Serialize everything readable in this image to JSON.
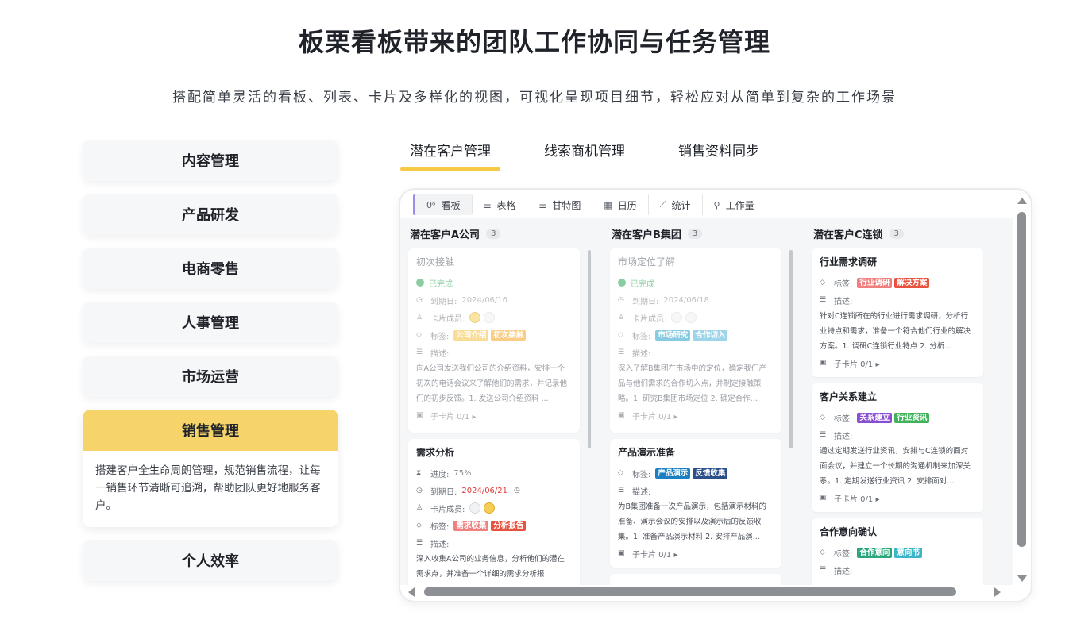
{
  "hero": {
    "title": "板栗看板带来的团队工作协同与任务管理",
    "subtitle": "搭配简单灵活的看板、列表、卡片及多样化的视图，可视化呈现项目细节，轻松应对从简单到复杂的工作场景"
  },
  "menu": {
    "items": [
      "内容管理",
      "产品研发",
      "电商零售",
      "人事管理",
      "市场运营"
    ],
    "active": {
      "label": "销售管理",
      "desc": "搭建客户全生命周朗管理，规范销售流程，让每一销售环节清晰可追溯，帮助团队更好地服务客户。"
    },
    "after": [
      "个人效率"
    ]
  },
  "tabs": [
    "潜在客户管理",
    "线索商机管理",
    "销售资料同步"
  ],
  "toolbar": [
    {
      "icon": "kanban-icon",
      "glyph": "0ᵒ",
      "label": "看板"
    },
    {
      "icon": "list-icon",
      "glyph": "☰",
      "label": "表格"
    },
    {
      "icon": "gantt-icon",
      "glyph": "☰",
      "label": "甘特图"
    },
    {
      "icon": "calendar-icon",
      "glyph": "▦",
      "label": "日历"
    },
    {
      "icon": "chart-icon",
      "glyph": "⟋",
      "label": "统计"
    },
    {
      "icon": "workload-icon",
      "glyph": "⚲",
      "label": "工作量"
    }
  ],
  "labels": {
    "done": "已完成",
    "due": "到期日:",
    "members": "卡片成员:",
    "tags": "标签:",
    "desc": "描述:",
    "subcards": "子卡片 0/1 ▸",
    "progress": "进度:"
  },
  "columns": [
    {
      "name": "潜在客户A公司",
      "count": "3",
      "cards": [
        {
          "title": "初次接触",
          "dim": true,
          "done": true,
          "due": "2024/06/16",
          "due_red": false,
          "avatars": [
            "y",
            "g"
          ],
          "tags": [
            {
              "text": "公司介绍",
              "color": "#f5c242"
            },
            {
              "text": "初次接触",
              "color": "#f5a623"
            }
          ],
          "desc": "向A公司发送我们公司的介绍资料，安排一个初次的电话会议来了解他们的需求，并记录他们的初步反馈。1. 发送公司介绍资料 ..."
        },
        {
          "title": "需求分析",
          "dim": false,
          "progress": "75%",
          "due": "2024/06/21",
          "due_red": true,
          "avatars": [
            "g",
            "y"
          ],
          "tags": [
            {
              "text": "需求收集",
              "color": "#f07f7f"
            },
            {
              "text": "分析报告",
              "color": "#e8533f"
            }
          ],
          "desc": "深入收集A公司的业务信息，分析他们的潜在需求点，并准备一个详细的需求分析报"
        }
      ]
    },
    {
      "name": "潜在客户B集团",
      "count": "3",
      "cards": [
        {
          "title": "市场定位了解",
          "dim": true,
          "done": true,
          "due": "2024/06/18",
          "due_red": false,
          "avatars": [
            "g",
            "g"
          ],
          "tags": [
            {
              "text": "市场研究",
              "color": "#28a2c7"
            },
            {
              "text": "合作切入",
              "color": "#4fb3d9"
            }
          ],
          "desc": "深入了解B集团在市场中的定位，确定我们产品与他们需求的合作切入点，并制定接触策略。1. 研究B集团市场定位 2. 确定合作..."
        },
        {
          "title": "产品演示准备",
          "dim": false,
          "tags": [
            {
              "text": "产品演示",
              "color": "#1b7fc4"
            },
            {
              "text": "反馈收集",
              "color": "#2b4f8a"
            }
          ],
          "desc": "为B集团准备一次产品演示，包括演示材料的准备、演示会议的安排以及演示后的反馈收集。1. 准备产品演示材料 2. 安排产品演..."
        }
      ]
    },
    {
      "name": "潜在客户C连锁",
      "count": "3",
      "cards": [
        {
          "title": "行业需求调研",
          "dim": false,
          "tags": [
            {
              "text": "行业调研",
              "color": "#f07f7f"
            },
            {
              "text": "解决方案",
              "color": "#e8533f"
            }
          ],
          "desc": "针对C连锁所在的行业进行需求调研，分析行业特点和需求，准备一个符合他们行业的解决方案。1. 调研C连锁行业特点 2. 分析..."
        },
        {
          "title": "客户关系建立",
          "dim": false,
          "tags": [
            {
              "text": "关系建立",
              "color": "#8a4fd0"
            },
            {
              "text": "行业资讯",
              "color": "#3fb35a"
            }
          ],
          "desc": "通过定期发送行业资讯，安排与C连锁的面对面会议，并建立一个长期的沟通机制来加深关系。1. 定期发送行业资讯 2. 安排面对..."
        },
        {
          "title": "合作意向确认",
          "dim": false,
          "tags": [
            {
              "text": "合作意向",
              "color": "#2aa67a"
            },
            {
              "text": "意向书",
              "color": "#3cb5c9"
            }
          ],
          "desc": ""
        }
      ]
    }
  ]
}
